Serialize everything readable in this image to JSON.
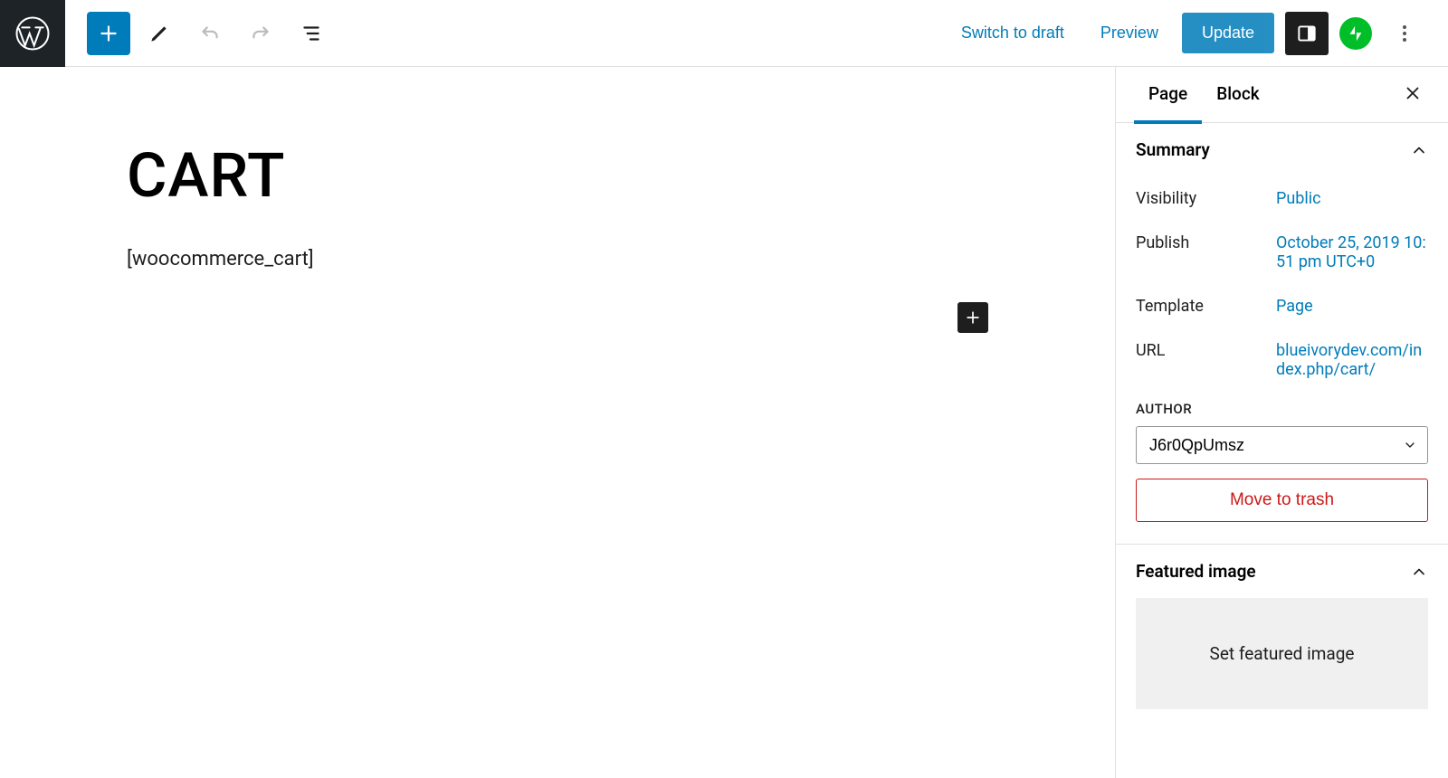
{
  "topbar": {
    "switch_to_draft": "Switch to draft",
    "preview": "Preview",
    "update": "Update"
  },
  "editor": {
    "title": "CART",
    "body": "[woocommerce_cart]"
  },
  "sidebar": {
    "tabs": {
      "page": "Page",
      "block": "Block"
    },
    "summary": {
      "heading": "Summary",
      "visibility_label": "Visibility",
      "visibility_value": "Public",
      "publish_label": "Publish",
      "publish_value": "October 25, 2019 10:51 pm UTC+0",
      "template_label": "Template",
      "template_value": "Page",
      "url_label": "URL",
      "url_value": "blueivorydev.com/index.php/cart/",
      "author_label": "AUTHOR",
      "author_value": "J6r0QpUmsz",
      "trash": "Move to trash"
    },
    "featured_image": {
      "heading": "Featured image",
      "button": "Set featured image"
    }
  }
}
